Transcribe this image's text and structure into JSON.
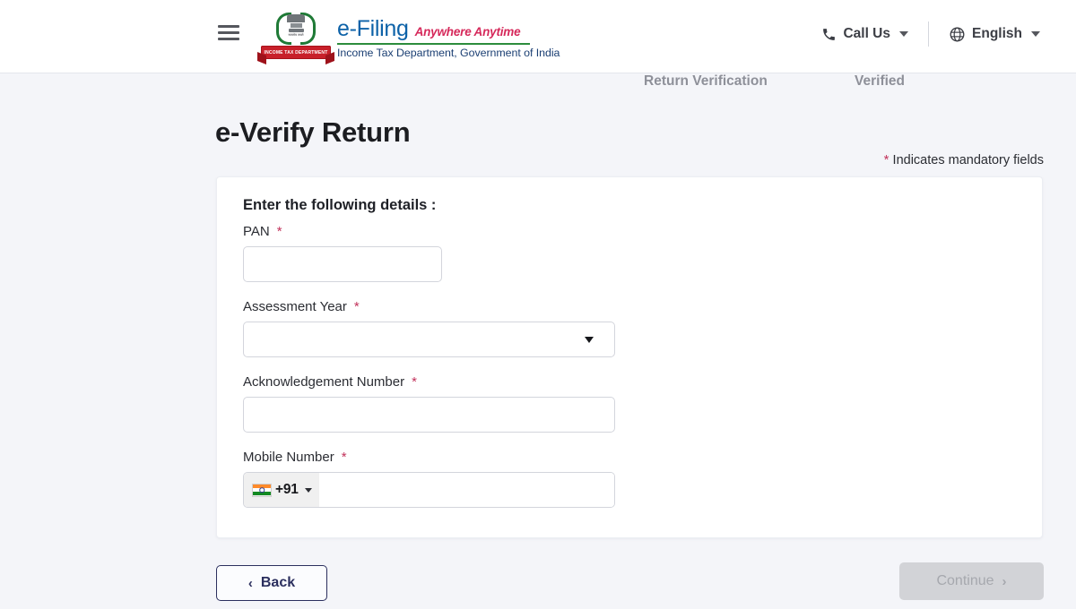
{
  "header": {
    "menu_icon": "hamburger-icon",
    "logo": {
      "brand": "e-Filing",
      "tagline": "Anywhere Anytime",
      "subtitle": "Income Tax Department, Government of India",
      "emblem_ribbon": "INCOME TAX DEPARTMENT",
      "emblem_motto": "सत्यमेव जयते",
      "brand_color": "#0d62a8",
      "tagline_color": "#d6285a",
      "rule_color": "#2c8c3c",
      "subtitle_color": "#1b3f73"
    },
    "call_us": "Call Us",
    "language": "English"
  },
  "stepper": {
    "steps": [
      {
        "label": "Return Verification"
      },
      {
        "label": "Verified"
      }
    ]
  },
  "page": {
    "title": "e-Verify Return",
    "mandatory_star": "*",
    "mandatory_note": "Indicates mandatory fields"
  },
  "form": {
    "heading": "Enter the following details :",
    "required_star": "*",
    "fields": [
      {
        "label": "PAN",
        "value": "",
        "placeholder": "",
        "type": "text"
      },
      {
        "label": "Assessment Year",
        "value": "",
        "placeholder": "",
        "type": "select"
      },
      {
        "label": "Acknowledgement Number",
        "value": "",
        "placeholder": "",
        "type": "text"
      },
      {
        "label": "Mobile Number",
        "value": "",
        "placeholder": "",
        "type": "tel"
      }
    ],
    "country_code": "+91",
    "country_flag": "india-flag-icon"
  },
  "footer": {
    "back_label": "Back",
    "back_chevron": "‹",
    "continue_label": "Continue",
    "continue_chevron": "›",
    "continue_disabled": true
  },
  "colors": {
    "page_bg": "#f4f5f9",
    "card_bg": "#ffffff",
    "primary": "#2b2f5e",
    "required": "#c2325b",
    "disabled_btn": "#d2d3d7"
  }
}
